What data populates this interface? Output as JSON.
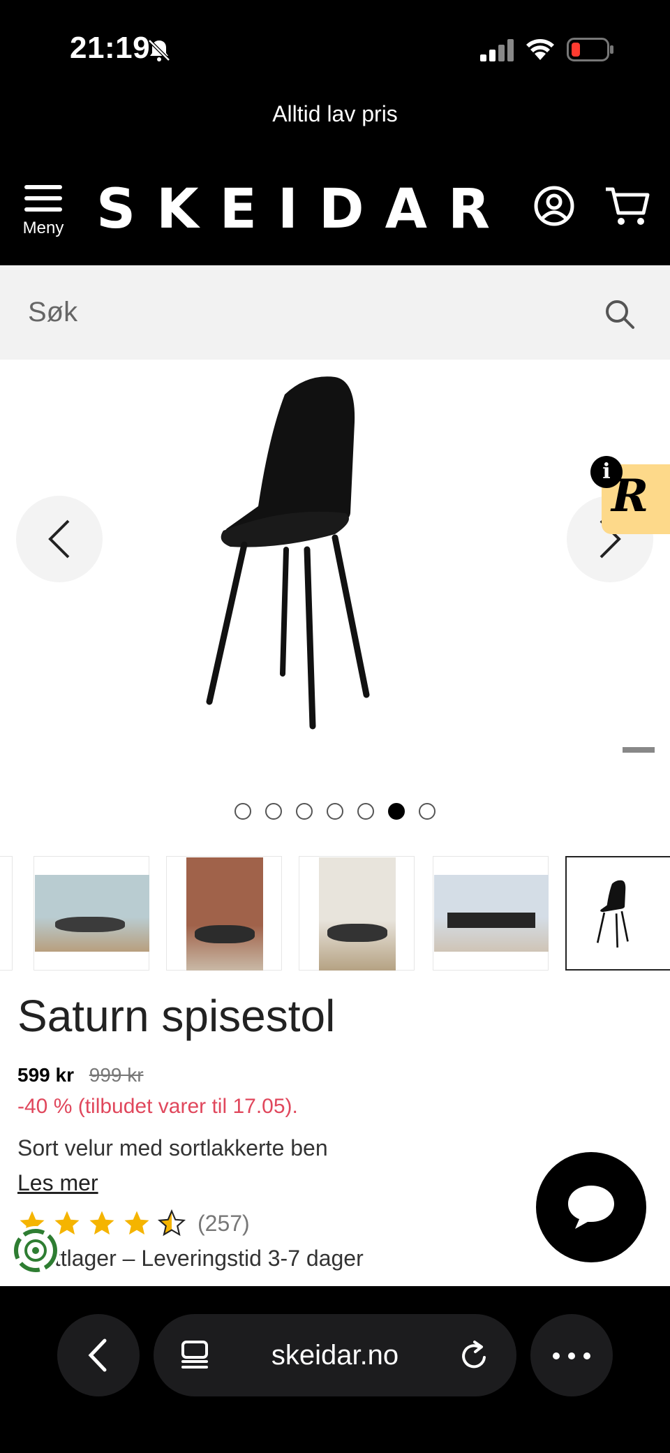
{
  "status_bar": {
    "time": "21:19",
    "battery_color": "#ff3b30"
  },
  "promo": {
    "text": "Alltid lav pris"
  },
  "header": {
    "logo": "SKEIDAR",
    "menu_label": "Meny"
  },
  "search": {
    "placeholder": "Søk"
  },
  "gallery": {
    "dot_count": 7,
    "active_index": 5
  },
  "product": {
    "title": "Saturn spisestol",
    "price": "599 kr",
    "old_price": "999 kr",
    "discount": "-40 % (tilbudet varer til 17.05).",
    "description": "Sort velur med sortlakkerte ben",
    "read_more": "Les mer",
    "rating": 4.5,
    "rating_count": "(257)",
    "stock": "ettlager – Leveringstid 3-7 dager"
  },
  "browser": {
    "url": "skeidar.no"
  },
  "colors": {
    "accent_red": "#e0475c",
    "rating_star": "#f5b400",
    "badge_yellow": "#fdd98a"
  }
}
